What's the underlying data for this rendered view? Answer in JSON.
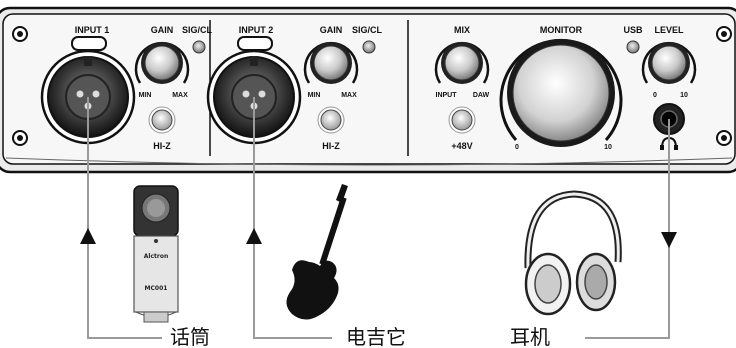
{
  "panel": {
    "input1_label": "INPUT 1",
    "input2_label": "INPUT 2",
    "gain_label": "GAIN",
    "sigcl_label": "SIG/CL",
    "min_label": "MIN",
    "max_label": "MAX",
    "hiz_label": "HI-Z",
    "mix_label": "MIX",
    "mix_input_label": "INPUT",
    "mix_daw_label": "DAW",
    "phantom_label": "+48V",
    "monitor_label": "MONITOR",
    "monitor_min": "0",
    "monitor_max": "10",
    "usb_label": "USB",
    "level_label": "LEVEL",
    "level_min": "0",
    "level_max": "10"
  },
  "devices": {
    "mic_label": "话筒",
    "guitar_label": "电吉它",
    "headphones_label": "耳机",
    "mic_brand": "Alctron",
    "mic_model": "MC001"
  },
  "colors": {
    "panel_fill": "#f7f7f7",
    "outline": "#111111",
    "connector_line": "#9a9a9a",
    "arrow": "#111111"
  }
}
